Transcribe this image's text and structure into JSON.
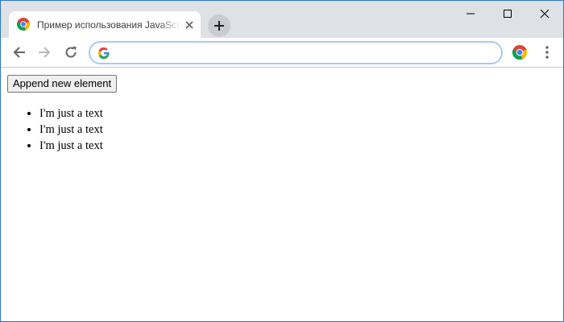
{
  "browser": {
    "tab": {
      "title": "Пример использования JavaScript"
    },
    "omnibox": {
      "value": "",
      "placeholder": ""
    },
    "icons": {
      "favicon": "chrome-icon",
      "close": "close-icon",
      "new_tab": "plus-icon",
      "back": "arrow-left-icon",
      "forward": "arrow-right-icon",
      "reload": "reload-icon",
      "search_engine": "google-g-icon",
      "profile": "chrome-profile-icon",
      "menu": "kebab-menu-icon"
    },
    "colors": {
      "tabstrip": "#dee1e6",
      "omnibox_border": "#a8c7fa",
      "window_border": "#2a78c8"
    }
  },
  "page": {
    "append_button_label": "Append new element",
    "list_items": [
      "I'm just a text",
      "I'm just a text",
      "I'm just a text"
    ]
  }
}
